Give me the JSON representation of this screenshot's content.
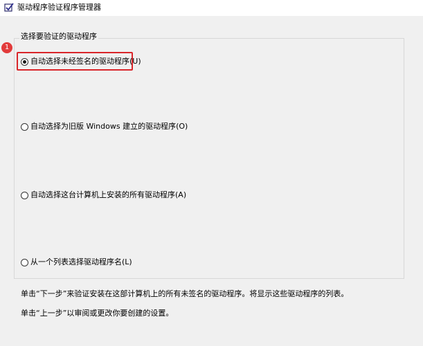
{
  "window": {
    "title": "驱动程序验证程序管理器",
    "icon": "checkbox-app-icon"
  },
  "group": {
    "legend": "选择要验证的驱动程序"
  },
  "options": [
    {
      "label": "自动选择未经签名的驱动程序(U)",
      "checked": true
    },
    {
      "label": "自动选择为旧版 Windows 建立的驱动程序(O)",
      "checked": false
    },
    {
      "label": "自动选择这台计算机上安装的所有驱动程序(A)",
      "checked": false
    },
    {
      "label": "从一个列表选择驱动程序名(L)",
      "checked": false
    }
  ],
  "annotation": {
    "badge": "1",
    "color": "#d9262a"
  },
  "descriptions": {
    "next": "单击“下一步”来验证安装在这部计算机上的所有未签名的驱动程序。将显示这些驱动程序的列表。",
    "back": "单击“上一步”以审阅或更改你要创建的设置。"
  }
}
